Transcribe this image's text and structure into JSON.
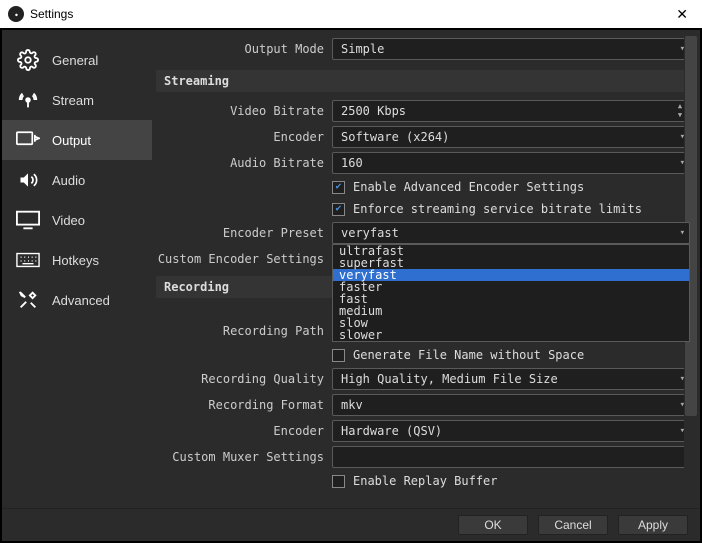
{
  "window": {
    "title": "Settings"
  },
  "sidebar": {
    "items": [
      {
        "label": "General"
      },
      {
        "label": "Stream"
      },
      {
        "label": "Output"
      },
      {
        "label": "Audio"
      },
      {
        "label": "Video"
      },
      {
        "label": "Hotkeys"
      },
      {
        "label": "Advanced"
      }
    ],
    "selected": "Output"
  },
  "top": {
    "output_mode_label": "Output Mode",
    "output_mode_value": "Simple"
  },
  "streaming": {
    "group_label": "Streaming",
    "video_bitrate_label": "Video Bitrate",
    "video_bitrate_value": "2500 Kbps",
    "encoder_label": "Encoder",
    "encoder_value": "Software (x264)",
    "audio_bitrate_label": "Audio Bitrate",
    "audio_bitrate_value": "160",
    "enable_advanced_label": "Enable Advanced Encoder Settings",
    "enforce_limits_label": "Enforce streaming service bitrate limits",
    "encoder_preset_label": "Encoder Preset",
    "encoder_preset_value": "veryfast",
    "encoder_preset_options": [
      "ultrafast",
      "superfast",
      "veryfast",
      "faster",
      "fast",
      "medium",
      "slow",
      "slower"
    ],
    "custom_encoder_label": "Custom Encoder Settings"
  },
  "recording": {
    "group_label": "Recording",
    "path_label": "Recording Path",
    "filename_nospace_label": "Generate File Name without Space",
    "quality_label": "Recording Quality",
    "quality_value": "High Quality, Medium File Size",
    "format_label": "Recording Format",
    "format_value": "mkv",
    "encoder_label": "Encoder",
    "encoder_value": "Hardware (QSV)",
    "muxer_label": "Custom Muxer Settings",
    "replay_buffer_label": "Enable Replay Buffer"
  },
  "footer": {
    "ok": "OK",
    "cancel": "Cancel",
    "apply": "Apply"
  }
}
